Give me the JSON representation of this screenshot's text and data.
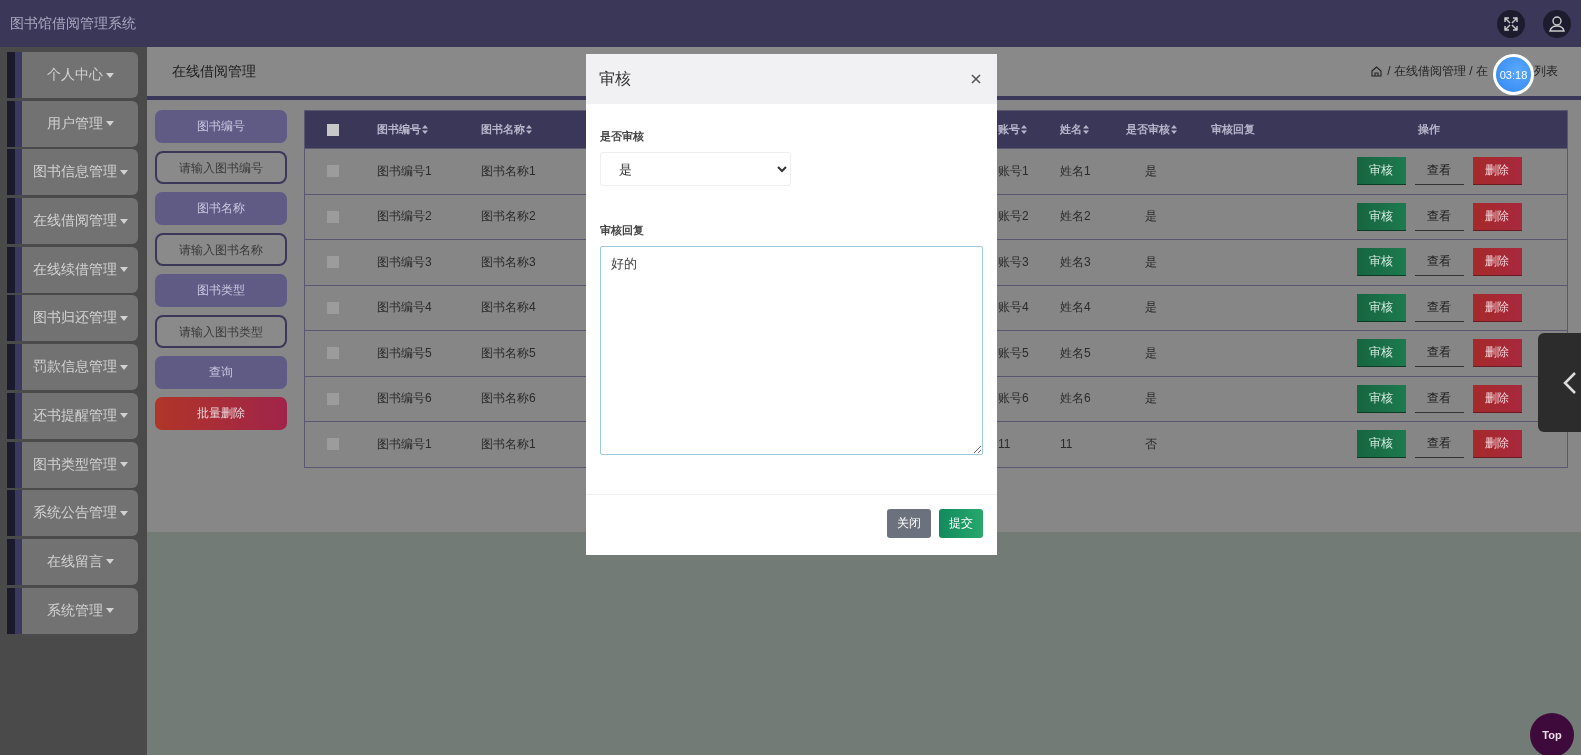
{
  "app": {
    "title": "图书馆借阅管理系统"
  },
  "sidebar": {
    "items": [
      {
        "label": "个人中心"
      },
      {
        "label": "用户管理"
      },
      {
        "label": "图书信息管理"
      },
      {
        "label": "在线借阅管理"
      },
      {
        "label": "在线续借管理"
      },
      {
        "label": "图书归还管理"
      },
      {
        "label": "罚款信息管理"
      },
      {
        "label": "还书提醒管理"
      },
      {
        "label": "图书类型管理"
      },
      {
        "label": "系统公告管理"
      },
      {
        "label": "在线留言"
      },
      {
        "label": "系统管理"
      }
    ]
  },
  "page": {
    "title": "在线借阅管理",
    "breadcrumb_start": "/ 在线借阅管理 / 在",
    "breadcrumb_end": "列表"
  },
  "recording_timer": "03:18",
  "filters": [
    {
      "kind": "label",
      "text": "图书编号"
    },
    {
      "kind": "input",
      "placeholder": "请输入图书编号"
    },
    {
      "kind": "label",
      "text": "图书名称"
    },
    {
      "kind": "input",
      "placeholder": "请输入图书名称"
    },
    {
      "kind": "label",
      "text": "图书类型"
    },
    {
      "kind": "input",
      "placeholder": "请输入图书类型"
    },
    {
      "kind": "query",
      "text": "查询"
    },
    {
      "kind": "danger",
      "text": "批量删除"
    }
  ],
  "table": {
    "select_all_checked": false,
    "columns": [
      {
        "label": "图书编号",
        "sortable": true
      },
      {
        "label": "图书名称",
        "sortable": true
      },
      {
        "label": "账号",
        "sortable": true
      },
      {
        "label": "姓名",
        "sortable": true
      },
      {
        "label": "是否审核",
        "sortable": true
      },
      {
        "label": "审核回复",
        "sortable": false
      },
      {
        "label": "操作",
        "sortable": false
      }
    ],
    "rows": [
      {
        "checked": false,
        "book_no": "图书编号1",
        "book_name": "图书名称1",
        "account": "账号1",
        "name": "姓名1",
        "audited": "是",
        "actions": [
          {
            "kind": "approve",
            "label": "审核"
          },
          {
            "kind": "view",
            "label": "查看"
          },
          {
            "kind": "delete",
            "label": "删除"
          }
        ]
      },
      {
        "checked": false,
        "book_no": "图书编号2",
        "book_name": "图书名称2",
        "account": "账号2",
        "name": "姓名2",
        "audited": "是",
        "actions": [
          {
            "kind": "approve",
            "label": "审核"
          },
          {
            "kind": "view",
            "label": "查看"
          },
          {
            "kind": "delete",
            "label": "删除"
          }
        ]
      },
      {
        "checked": false,
        "book_no": "图书编号3",
        "book_name": "图书名称3",
        "account": "账号3",
        "name": "姓名3",
        "audited": "是",
        "actions": [
          {
            "kind": "approve",
            "label": "审核"
          },
          {
            "kind": "view",
            "label": "查看"
          },
          {
            "kind": "delete",
            "label": "删除"
          }
        ]
      },
      {
        "checked": false,
        "book_no": "图书编号4",
        "book_name": "图书名称4",
        "account": "账号4",
        "name": "姓名4",
        "audited": "是",
        "actions": [
          {
            "kind": "approve",
            "label": "审核"
          },
          {
            "kind": "view",
            "label": "查看"
          },
          {
            "kind": "delete",
            "label": "删除"
          }
        ]
      },
      {
        "checked": false,
        "book_no": "图书编号5",
        "book_name": "图书名称5",
        "account": "账号5",
        "name": "姓名5",
        "audited": "是",
        "actions": [
          {
            "kind": "approve",
            "label": "审核"
          },
          {
            "kind": "view",
            "label": "查看"
          },
          {
            "kind": "delete",
            "label": "删除"
          }
        ]
      },
      {
        "checked": false,
        "book_no": "图书编号6",
        "book_name": "图书名称6",
        "account": "账号6",
        "name": "姓名6",
        "audited": "是",
        "actions": [
          {
            "kind": "approve",
            "label": "审核"
          },
          {
            "kind": "view",
            "label": "查看"
          },
          {
            "kind": "delete",
            "label": "删除"
          }
        ]
      },
      {
        "checked": false,
        "book_no": "图书编号1",
        "book_name": "图书名称1",
        "account": "11",
        "name": "11",
        "audited": "否",
        "actions": [
          {
            "kind": "approve",
            "label": "审核"
          },
          {
            "kind": "view",
            "label": "查看"
          },
          {
            "kind": "delete",
            "label": "删除"
          }
        ]
      }
    ]
  },
  "modal": {
    "title": "审核",
    "fields": [
      {
        "kind": "select",
        "label": "是否审核",
        "value": "是"
      },
      {
        "kind": "textarea",
        "label": "审核回复",
        "value": "好的"
      }
    ],
    "buttons": [
      {
        "kind": "secondary",
        "label": "关闭"
      },
      {
        "kind": "primary",
        "label": "提交"
      }
    ]
  },
  "top_button": "Top"
}
